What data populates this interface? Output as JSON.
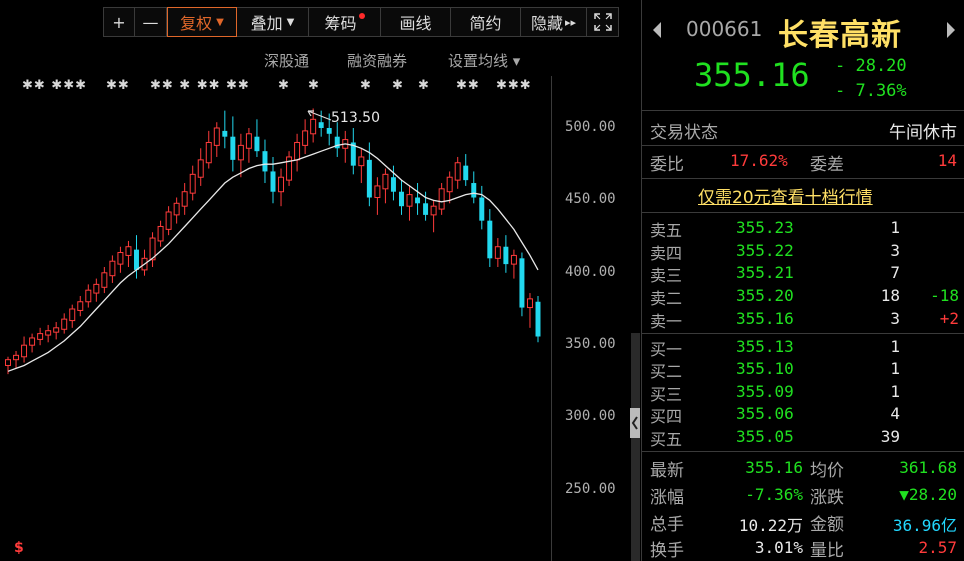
{
  "toolbar": {
    "plus": "+",
    "minus": "—",
    "fuquan": "复权",
    "diejia": "叠加",
    "chouma": "筹码",
    "huaxian": "画线",
    "jianyue": "简约",
    "yincang": "隐藏",
    "expand_icon": "expand-icon",
    "dropdown_arrow": "▼",
    "play_arrow": "▸▸"
  },
  "subbar": {
    "shengutong": "深股通",
    "rongzi": "融资融券",
    "junxian": "设置均线",
    "junxian_arrow": "▾"
  },
  "stars": [
    "✱✱ ✱✱✱",
    "✱✱",
    "✱✱ ✱ ✱✱",
    "✱✱",
    "✱",
    "✱",
    "✱",
    "✱",
    "✱",
    "✱✱",
    "✱✱✱"
  ],
  "chart": {
    "peak_label": "513.50",
    "y_labels": [
      "500.00",
      "450.00",
      "400.00",
      "350.00",
      "300.00",
      "250.00"
    ],
    "bottom_icon": "$"
  },
  "chart_data": {
    "type": "candlestick",
    "y_ticks": [
      500,
      450,
      400,
      350,
      300,
      250
    ],
    "peak": 513.5,
    "candles": [
      [
        336,
        342,
        330,
        340
      ],
      [
        340,
        346,
        334,
        343
      ],
      [
        342,
        356,
        338,
        350
      ],
      [
        350,
        358,
        345,
        355
      ],
      [
        354,
        362,
        350,
        358
      ],
      [
        357,
        364,
        352,
        360
      ],
      [
        359,
        366,
        354,
        362
      ],
      [
        361,
        372,
        358,
        368
      ],
      [
        367,
        378,
        362,
        375
      ],
      [
        374,
        384,
        370,
        380
      ],
      [
        380,
        392,
        376,
        388
      ],
      [
        386,
        396,
        380,
        392
      ],
      [
        390,
        404,
        386,
        400
      ],
      [
        398,
        412,
        393,
        408
      ],
      [
        406,
        418,
        400,
        414
      ],
      [
        412,
        422,
        404,
        418
      ],
      [
        416,
        426,
        396,
        402
      ],
      [
        402,
        416,
        398,
        410
      ],
      [
        409,
        428,
        404,
        424
      ],
      [
        422,
        436,
        418,
        432
      ],
      [
        430,
        446,
        426,
        442
      ],
      [
        440,
        452,
        434,
        448
      ],
      [
        446,
        462,
        440,
        456
      ],
      [
        455,
        474,
        450,
        468
      ],
      [
        466,
        486,
        460,
        478
      ],
      [
        476,
        498,
        472,
        490
      ],
      [
        488,
        504,
        480,
        500
      ],
      [
        498,
        512,
        486,
        494
      ],
      [
        494,
        508,
        470,
        478
      ],
      [
        478,
        496,
        466,
        488
      ],
      [
        486,
        500,
        476,
        496
      ],
      [
        494,
        506,
        480,
        484
      ],
      [
        484,
        492,
        462,
        470
      ],
      [
        470,
        480,
        448,
        456
      ],
      [
        456,
        472,
        446,
        466
      ],
      [
        464,
        484,
        460,
        480
      ],
      [
        478,
        496,
        470,
        490
      ],
      [
        488,
        506,
        482,
        498
      ],
      [
        496,
        513.5,
        490,
        506
      ],
      [
        504,
        512,
        494,
        500
      ],
      [
        500,
        510,
        488,
        496
      ],
      [
        494,
        504,
        480,
        486
      ],
      [
        486,
        498,
        476,
        492
      ],
      [
        490,
        500,
        468,
        474
      ],
      [
        474,
        486,
        462,
        480
      ],
      [
        478,
        490,
        446,
        452
      ],
      [
        452,
        466,
        440,
        460
      ],
      [
        458,
        472,
        448,
        468
      ],
      [
        466,
        474,
        450,
        456
      ],
      [
        456,
        464,
        440,
        446
      ],
      [
        446,
        460,
        436,
        454
      ],
      [
        452,
        462,
        440,
        448
      ],
      [
        448,
        456,
        436,
        440
      ],
      [
        440,
        450,
        428,
        446
      ],
      [
        444,
        462,
        440,
        458
      ],
      [
        456,
        470,
        448,
        466
      ],
      [
        464,
        480,
        458,
        476
      ],
      [
        474,
        482,
        460,
        464
      ],
      [
        462,
        470,
        448,
        452
      ],
      [
        452,
        460,
        430,
        436
      ],
      [
        436,
        444,
        404,
        410
      ],
      [
        410,
        424,
        404,
        418
      ],
      [
        418,
        426,
        400,
        406
      ],
      [
        406,
        416,
        396,
        412
      ],
      [
        410,
        414,
        370,
        376
      ],
      [
        376,
        386,
        362,
        382
      ],
      [
        380,
        384,
        352,
        356
      ]
    ],
    "ma": [
      332,
      334,
      336,
      339,
      342,
      345,
      349,
      353,
      358,
      363,
      369,
      375,
      381,
      387,
      393,
      398,
      402,
      406,
      410,
      415,
      420,
      426,
      432,
      438,
      444,
      450,
      456,
      462,
      466,
      469,
      472,
      474,
      475,
      475,
      476,
      477,
      478,
      480,
      482,
      484,
      486,
      488,
      489,
      488,
      486,
      483,
      479,
      474,
      469,
      464,
      460,
      456,
      452,
      450,
      449,
      450,
      452,
      454,
      455,
      454,
      450,
      444,
      437,
      430,
      421,
      412,
      402
    ]
  },
  "panel": {
    "code": "000661",
    "name": "长春高新",
    "price": "355.16",
    "change": "- 28.20",
    "change_pct": "- 7.36%",
    "status_label": "交易状态",
    "status_value": "午间休市",
    "weibi_label": "委比",
    "weibi_value": "17.62%",
    "weicha_label": "委差",
    "weicha_value": "14",
    "promo": "仅需20元查看十档行情",
    "asks": [
      {
        "label": "卖五",
        "price": "355.23",
        "vol": "1",
        "chg": ""
      },
      {
        "label": "卖四",
        "price": "355.22",
        "vol": "3",
        "chg": ""
      },
      {
        "label": "卖三",
        "price": "355.21",
        "vol": "7",
        "chg": ""
      },
      {
        "label": "卖二",
        "price": "355.20",
        "vol": "18",
        "chg": "-18"
      },
      {
        "label": "卖一",
        "price": "355.16",
        "vol": "3",
        "chg": "+2"
      }
    ],
    "bids": [
      {
        "label": "买一",
        "price": "355.13",
        "vol": "1"
      },
      {
        "label": "买二",
        "price": "355.10",
        "vol": "1"
      },
      {
        "label": "买三",
        "price": "355.09",
        "vol": "1"
      },
      {
        "label": "买四",
        "price": "355.06",
        "vol": "4"
      },
      {
        "label": "买五",
        "price": "355.05",
        "vol": "39"
      }
    ],
    "stats": {
      "latest_label": "最新",
      "latest": "355.16",
      "avg_label": "均价",
      "avg": "361.68",
      "pct_label": "涨幅",
      "pct": "-7.36%",
      "chg_label": "涨跌",
      "chg": "▼28.20",
      "vol_label": "总手",
      "vol": "10.22万",
      "amt_label": "金额",
      "amt": "36.96亿",
      "turn_label": "换手",
      "turn": "3.01%",
      "ratio_label": "量比",
      "ratio": "2.57"
    },
    "colors": {
      "up": "#ff3b3b",
      "down": "#20e020",
      "accent": "#e0672a",
      "name": "#ffe066"
    }
  }
}
